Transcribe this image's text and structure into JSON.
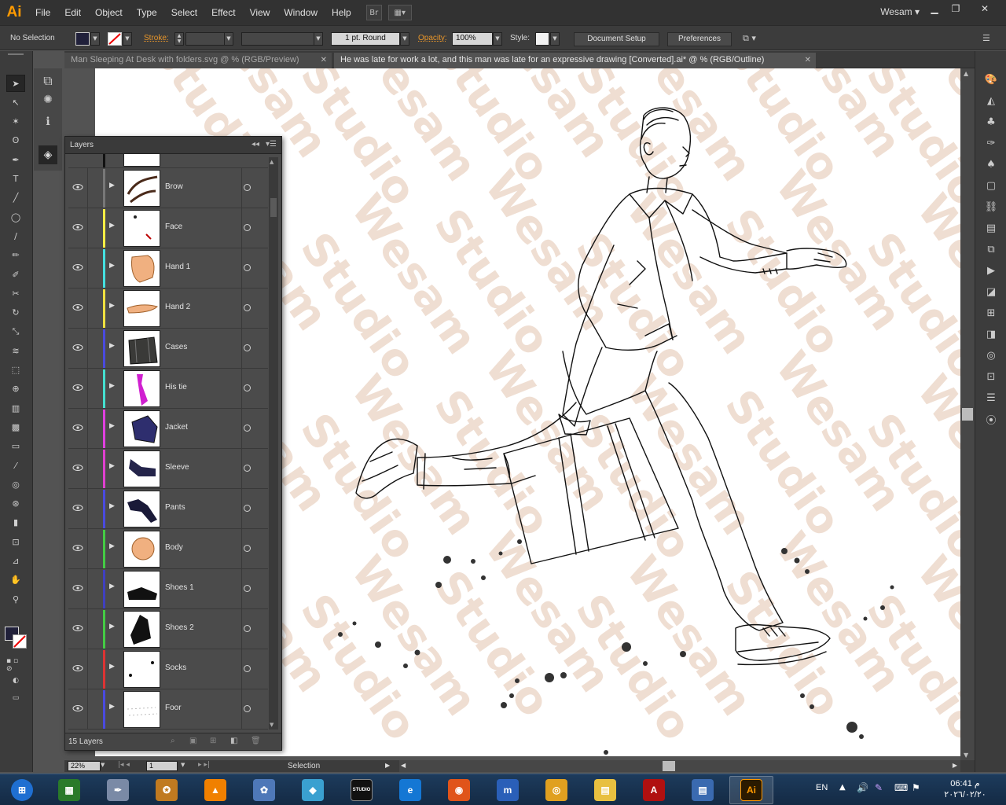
{
  "app": {
    "logo": "Ai",
    "menu": [
      "File",
      "Edit",
      "Object",
      "Type",
      "Select",
      "Effect",
      "View",
      "Window",
      "Help"
    ],
    "bridge_label": "Br",
    "user": "Wesam"
  },
  "control_bar": {
    "selection": "No Selection",
    "stroke_label": "Stroke:",
    "brush": "1 pt. Round",
    "opacity_label": "Opacity:",
    "opacity": "100%",
    "style_label": "Style:",
    "document_setup": "Document Setup",
    "preferences": "Preferences"
  },
  "tabs": [
    {
      "label": "Man Sleeping At Desk with folders.svg @ % (RGB/Preview)",
      "close": "✕"
    },
    {
      "label": "He was late for work a lot, and this man was late for an expressive drawing [Converted].ai* @ % (RGB/Outline)",
      "close": "✕"
    }
  ],
  "layers": {
    "title": "Layers",
    "count": "15 Layers",
    "items": [
      {
        "name": "Brow",
        "color": "#777777"
      },
      {
        "name": "Face",
        "color": "#ffee44"
      },
      {
        "name": "Hand 1",
        "color": "#44e0e0"
      },
      {
        "name": "Hand 2",
        "color": "#f0e040"
      },
      {
        "name": "Cases",
        "color": "#4a4adf"
      },
      {
        "name": "His tie",
        "color": "#44e0d0"
      },
      {
        "name": "Jacket",
        "color": "#e040e0"
      },
      {
        "name": "Sleeve",
        "color": "#e040d0"
      },
      {
        "name": "Pants",
        "color": "#4a4adf"
      },
      {
        "name": "Body",
        "color": "#44cc44"
      },
      {
        "name": "Shoes 1",
        "color": "#4040c0"
      },
      {
        "name": "Shoes 2",
        "color": "#44cc44"
      },
      {
        "name": "Socks",
        "color": "#dd3333"
      },
      {
        "name": "Foor",
        "color": "#4a4adf"
      }
    ]
  },
  "watermark": [
    "Wesam",
    "Studio"
  ],
  "status": {
    "zoom": "22%",
    "artboard": "1",
    "tool": "Selection"
  },
  "taskbar": {
    "apps": [
      {
        "name": "start",
        "label": ""
      },
      {
        "name": "task-manager",
        "label": ""
      },
      {
        "name": "pen-tool-app",
        "label": ""
      },
      {
        "name": "beast-app",
        "label": ""
      },
      {
        "name": "vlc",
        "label": ""
      },
      {
        "name": "paint-app",
        "label": ""
      },
      {
        "name": "shapes-app",
        "label": ""
      },
      {
        "name": "studio-app",
        "label": "STUDIO"
      },
      {
        "name": "edge",
        "label": ""
      },
      {
        "name": "firefox",
        "label": ""
      },
      {
        "name": "maxthon",
        "label": ""
      },
      {
        "name": "chrome",
        "label": ""
      },
      {
        "name": "file-explorer",
        "label": ""
      },
      {
        "name": "acrobat",
        "label": ""
      },
      {
        "name": "document-app",
        "label": ""
      },
      {
        "name": "illustrator",
        "label": "Ai"
      }
    ],
    "language": "EN",
    "time": "06:41 م",
    "date": "٢٠٢٦/٠٢/٢٠"
  }
}
